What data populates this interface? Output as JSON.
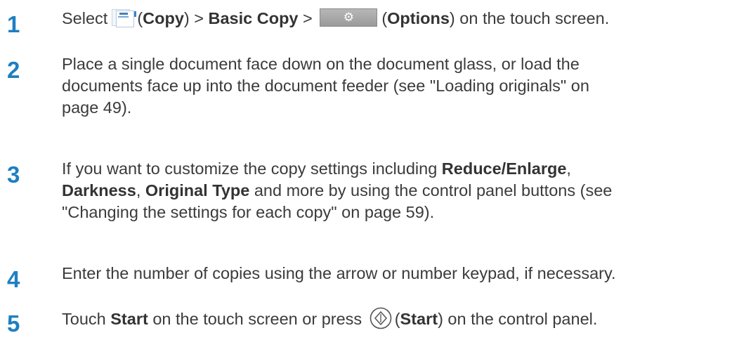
{
  "steps": [
    {
      "number": "1",
      "parts": {
        "a": "Select",
        "b": "(",
        "c": "Copy",
        "d": ") > ",
        "e": "Basic Copy",
        "f": " > ",
        "g": "(",
        "h": "Options",
        "i": ") on the touch screen."
      },
      "icons": [
        "copy-icon",
        "options-gear-icon"
      ]
    },
    {
      "number": "2",
      "lines": [
        "Place a single document face down on the document glass, or load the",
        "documents face up into the document feeder (see \"Loading originals\" on",
        "page 49)."
      ]
    },
    {
      "number": "3",
      "parts": {
        "a": "If you want to customize the copy settings including ",
        "b": "Reduce/Enlarge",
        "c": ",",
        "d": "Darkness",
        "e": ", ",
        "f": "Original Type",
        "g": " and more by using the control panel buttons (see",
        "h": "\"Changing the settings for each copy\" on page 59)."
      }
    },
    {
      "number": "4",
      "text": "Enter the number of copies using the arrow or number keypad, if necessary."
    },
    {
      "number": "5",
      "parts": {
        "a": "Touch ",
        "b": "Start",
        "c": " on the touch screen or press ",
        "d": "(",
        "e": "Start",
        "f": ") on the control panel."
      },
      "icons": [
        "start-button-icon"
      ]
    }
  ],
  "colors": {
    "step_number": "#1e7fc2",
    "body_text": "#3b3b3b"
  }
}
